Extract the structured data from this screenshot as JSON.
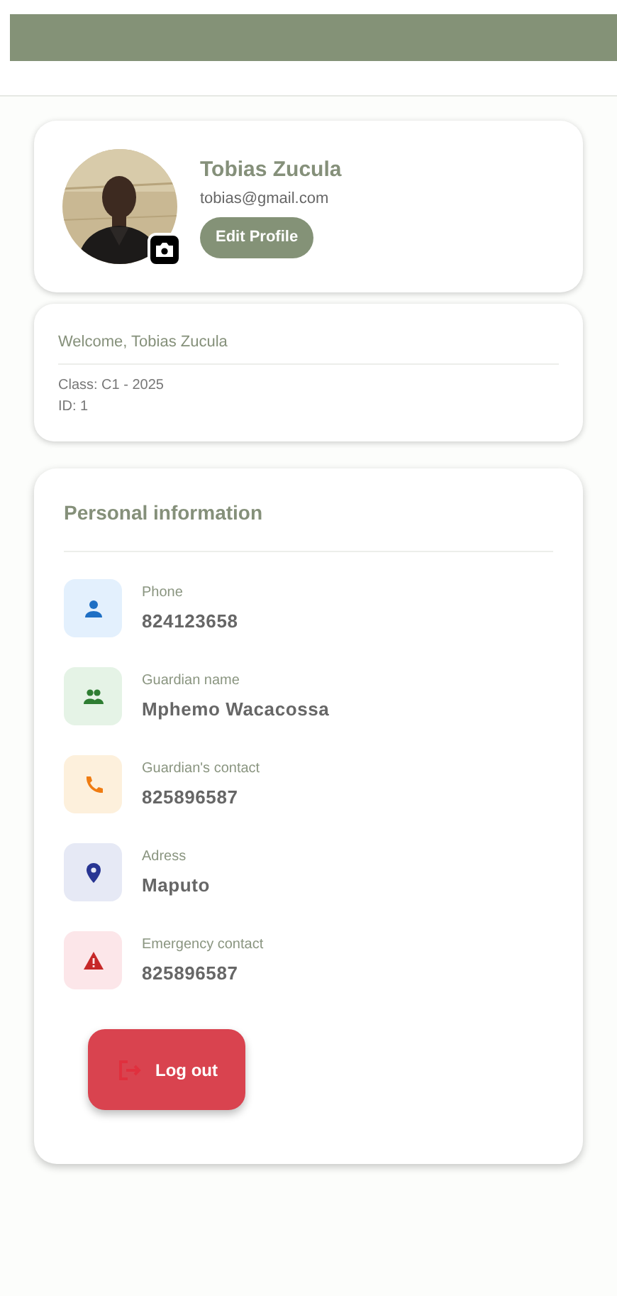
{
  "profile": {
    "name": "Tobias Zucula",
    "email": "tobias@gmail.com",
    "edit_button": "Edit Profile"
  },
  "welcome": {
    "greeting": "Welcome, Tobias Zucula",
    "class": "Class: C1 - 2025",
    "id": "ID: 1"
  },
  "personal_information": {
    "title": "Personal information",
    "items": [
      {
        "kind": "person",
        "label": "Phone",
        "value": "824123658"
      },
      {
        "kind": "group",
        "label": "Guardian name",
        "value": "Mphemo Wacacossa"
      },
      {
        "kind": "phone",
        "label": "Guardian's contact",
        "value": "825896587"
      },
      {
        "kind": "location",
        "label": "Adress",
        "value": "Maputo"
      },
      {
        "kind": "warning",
        "label": "Emergency contact",
        "value": "825896587"
      }
    ],
    "logout_button": "Log out"
  }
}
